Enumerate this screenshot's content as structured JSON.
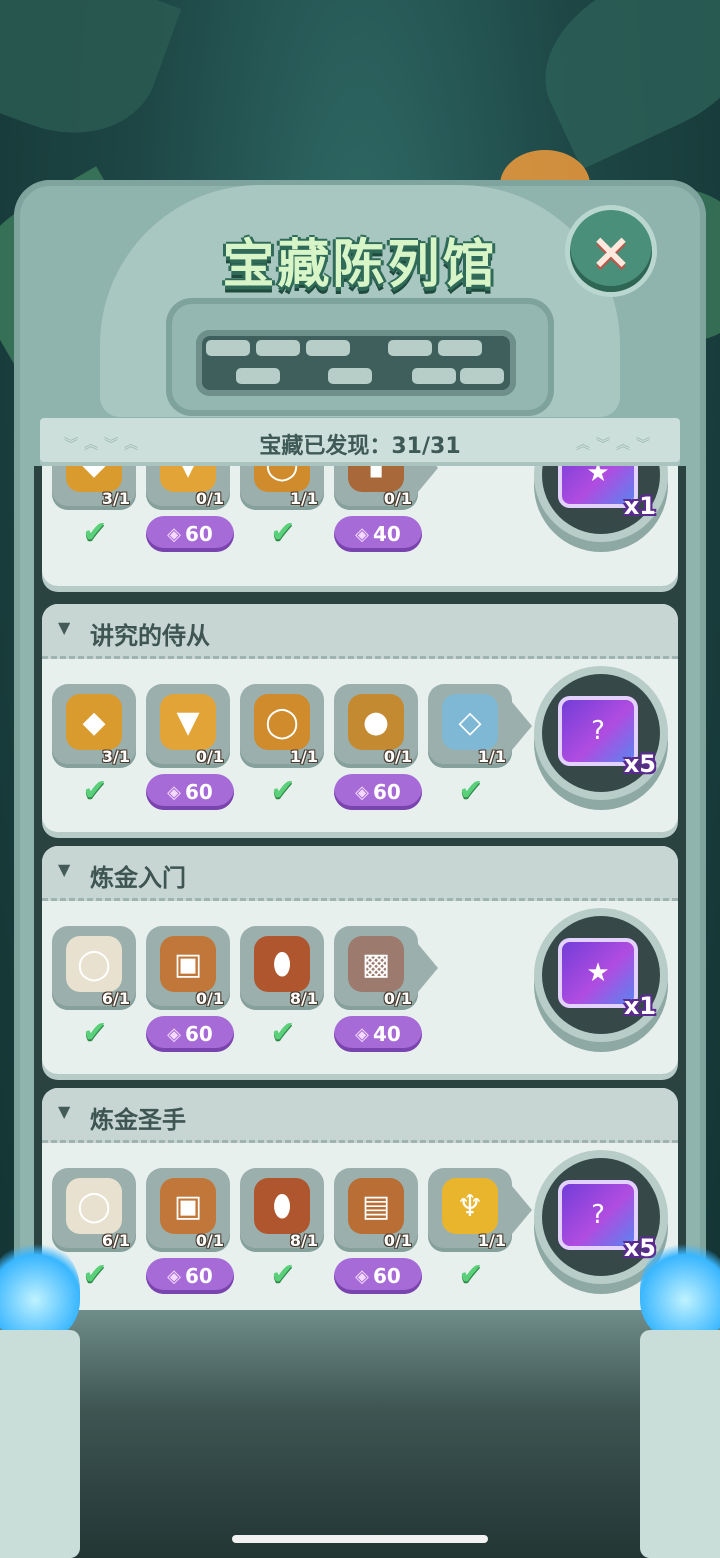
{
  "header": {
    "title": "宝藏陈列馆",
    "close_icon": "×",
    "discovered_label": "宝藏已发现：31/31"
  },
  "currency_icon": "diamond-gem",
  "accent_colors": {
    "gem_button": "#a76bd8",
    "check": "#5ad07a",
    "ticket": "#8a46e0"
  },
  "sets": [
    {
      "name": "",
      "items": [
        {
          "icon": "mickey-shield",
          "count": "3/1",
          "state": "collected"
        },
        {
          "icon": "golden-armor",
          "count": "0/1",
          "state": "buy",
          "price": "60"
        },
        {
          "icon": "golden-belt",
          "count": "1/1",
          "state": "collected"
        },
        {
          "icon": "leather-bracer",
          "count": "0/1",
          "state": "buy",
          "price": "40"
        }
      ],
      "reward": {
        "icon": "mickey-ticket",
        "qty": "x1"
      }
    },
    {
      "name": "讲究的侍从",
      "items": [
        {
          "icon": "mickey-shield",
          "count": "3/1",
          "state": "collected"
        },
        {
          "icon": "golden-armor",
          "count": "0/1",
          "state": "buy",
          "price": "60"
        },
        {
          "icon": "golden-belt",
          "count": "1/1",
          "state": "collected"
        },
        {
          "icon": "round-shield-emblem",
          "count": "0/1",
          "state": "buy",
          "price": "60"
        },
        {
          "icon": "crystal-sword",
          "count": "1/1",
          "state": "collected"
        }
      ],
      "reward": {
        "icon": "mystery-ticket",
        "qty": "x5"
      }
    },
    {
      "name": "炼金入门",
      "items": [
        {
          "icon": "bone-ring",
          "count": "6/1",
          "state": "collected"
        },
        {
          "icon": "tiki-mask",
          "count": "0/1",
          "state": "buy",
          "price": "60"
        },
        {
          "icon": "tribal-mask",
          "count": "8/1",
          "state": "collected"
        },
        {
          "icon": "stone-tablet",
          "count": "0/1",
          "state": "buy",
          "price": "40"
        }
      ],
      "reward": {
        "icon": "mickey-ticket",
        "qty": "x1"
      }
    },
    {
      "name": "炼金圣手",
      "items": [
        {
          "icon": "bone-ring",
          "count": "6/1",
          "state": "collected"
        },
        {
          "icon": "tiki-mask",
          "count": "0/1",
          "state": "buy",
          "price": "60"
        },
        {
          "icon": "tribal-mask",
          "count": "8/1",
          "state": "collected"
        },
        {
          "icon": "spell-book",
          "count": "0/1",
          "state": "buy",
          "price": "60"
        },
        {
          "icon": "golden-trophy",
          "count": "1/1",
          "state": "collected"
        }
      ],
      "reward": {
        "icon": "mystery-ticket",
        "qty": "x5"
      }
    }
  ]
}
